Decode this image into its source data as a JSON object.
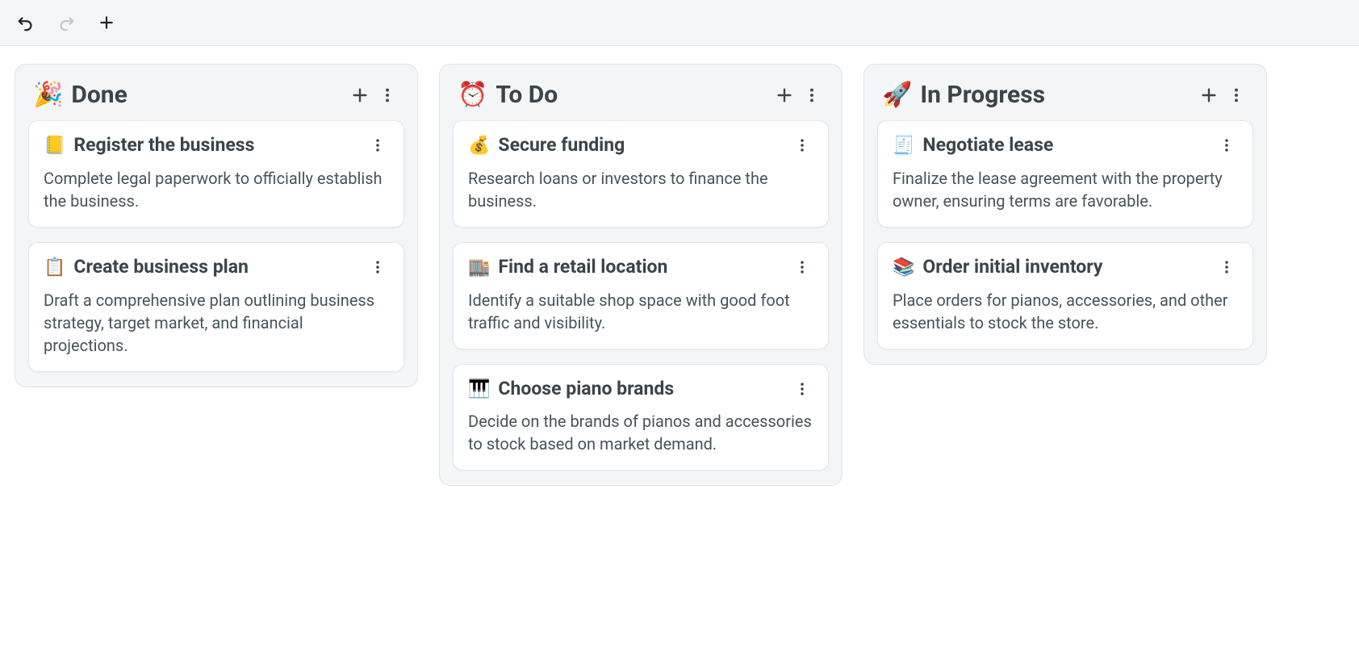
{
  "columns": [
    {
      "emoji": "🎉",
      "title": "Done",
      "cards": [
        {
          "emoji": "📒",
          "title": "Register the business",
          "desc": "Complete legal paperwork to officially establish the business."
        },
        {
          "emoji": "📋",
          "title": "Create business plan",
          "desc": "Draft a comprehensive plan outlining business strategy, target market, and financial projections."
        }
      ]
    },
    {
      "emoji": "⏰",
      "title": "To Do",
      "cards": [
        {
          "emoji": "💰",
          "title": "Secure funding",
          "desc": "Research loans or investors to finance the business."
        },
        {
          "emoji": "🏬",
          "title": "Find a retail location",
          "desc": "Identify a suitable shop space with good foot traffic and visibility."
        },
        {
          "emoji": "🎹",
          "title": "Choose piano brands",
          "desc": "Decide on the brands of pianos and accessories to stock based on market demand."
        }
      ]
    },
    {
      "emoji": "🚀",
      "title": "In Progress",
      "cards": [
        {
          "emoji": "🧾",
          "title": "Negotiate lease",
          "desc": "Finalize the lease agreement with the property owner, ensuring terms are favorable."
        },
        {
          "emoji": "📚",
          "title": "Order initial inventory",
          "desc": "Place orders for pianos, accessories, and other essentials to stock the store."
        }
      ]
    }
  ]
}
